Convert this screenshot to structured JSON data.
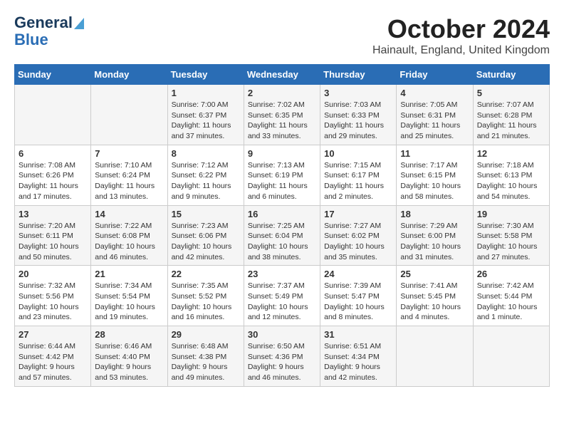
{
  "header": {
    "logo_line1": "General",
    "logo_line2": "Blue",
    "month": "October 2024",
    "location": "Hainault, England, United Kingdom"
  },
  "days_of_week": [
    "Sunday",
    "Monday",
    "Tuesday",
    "Wednesday",
    "Thursday",
    "Friday",
    "Saturday"
  ],
  "weeks": [
    [
      {
        "day": "",
        "info": ""
      },
      {
        "day": "",
        "info": ""
      },
      {
        "day": "1",
        "info": "Sunrise: 7:00 AM\nSunset: 6:37 PM\nDaylight: 11 hours\nand 37 minutes."
      },
      {
        "day": "2",
        "info": "Sunrise: 7:02 AM\nSunset: 6:35 PM\nDaylight: 11 hours\nand 33 minutes."
      },
      {
        "day": "3",
        "info": "Sunrise: 7:03 AM\nSunset: 6:33 PM\nDaylight: 11 hours\nand 29 minutes."
      },
      {
        "day": "4",
        "info": "Sunrise: 7:05 AM\nSunset: 6:31 PM\nDaylight: 11 hours\nand 25 minutes."
      },
      {
        "day": "5",
        "info": "Sunrise: 7:07 AM\nSunset: 6:28 PM\nDaylight: 11 hours\nand 21 minutes."
      }
    ],
    [
      {
        "day": "6",
        "info": "Sunrise: 7:08 AM\nSunset: 6:26 PM\nDaylight: 11 hours\nand 17 minutes."
      },
      {
        "day": "7",
        "info": "Sunrise: 7:10 AM\nSunset: 6:24 PM\nDaylight: 11 hours\nand 13 minutes."
      },
      {
        "day": "8",
        "info": "Sunrise: 7:12 AM\nSunset: 6:22 PM\nDaylight: 11 hours\nand 9 minutes."
      },
      {
        "day": "9",
        "info": "Sunrise: 7:13 AM\nSunset: 6:19 PM\nDaylight: 11 hours\nand 6 minutes."
      },
      {
        "day": "10",
        "info": "Sunrise: 7:15 AM\nSunset: 6:17 PM\nDaylight: 11 hours\nand 2 minutes."
      },
      {
        "day": "11",
        "info": "Sunrise: 7:17 AM\nSunset: 6:15 PM\nDaylight: 10 hours\nand 58 minutes."
      },
      {
        "day": "12",
        "info": "Sunrise: 7:18 AM\nSunset: 6:13 PM\nDaylight: 10 hours\nand 54 minutes."
      }
    ],
    [
      {
        "day": "13",
        "info": "Sunrise: 7:20 AM\nSunset: 6:11 PM\nDaylight: 10 hours\nand 50 minutes."
      },
      {
        "day": "14",
        "info": "Sunrise: 7:22 AM\nSunset: 6:08 PM\nDaylight: 10 hours\nand 46 minutes."
      },
      {
        "day": "15",
        "info": "Sunrise: 7:23 AM\nSunset: 6:06 PM\nDaylight: 10 hours\nand 42 minutes."
      },
      {
        "day": "16",
        "info": "Sunrise: 7:25 AM\nSunset: 6:04 PM\nDaylight: 10 hours\nand 38 minutes."
      },
      {
        "day": "17",
        "info": "Sunrise: 7:27 AM\nSunset: 6:02 PM\nDaylight: 10 hours\nand 35 minutes."
      },
      {
        "day": "18",
        "info": "Sunrise: 7:29 AM\nSunset: 6:00 PM\nDaylight: 10 hours\nand 31 minutes."
      },
      {
        "day": "19",
        "info": "Sunrise: 7:30 AM\nSunset: 5:58 PM\nDaylight: 10 hours\nand 27 minutes."
      }
    ],
    [
      {
        "day": "20",
        "info": "Sunrise: 7:32 AM\nSunset: 5:56 PM\nDaylight: 10 hours\nand 23 minutes."
      },
      {
        "day": "21",
        "info": "Sunrise: 7:34 AM\nSunset: 5:54 PM\nDaylight: 10 hours\nand 19 minutes."
      },
      {
        "day": "22",
        "info": "Sunrise: 7:35 AM\nSunset: 5:52 PM\nDaylight: 10 hours\nand 16 minutes."
      },
      {
        "day": "23",
        "info": "Sunrise: 7:37 AM\nSunset: 5:49 PM\nDaylight: 10 hours\nand 12 minutes."
      },
      {
        "day": "24",
        "info": "Sunrise: 7:39 AM\nSunset: 5:47 PM\nDaylight: 10 hours\nand 8 minutes."
      },
      {
        "day": "25",
        "info": "Sunrise: 7:41 AM\nSunset: 5:45 PM\nDaylight: 10 hours\nand 4 minutes."
      },
      {
        "day": "26",
        "info": "Sunrise: 7:42 AM\nSunset: 5:44 PM\nDaylight: 10 hours\nand 1 minute."
      }
    ],
    [
      {
        "day": "27",
        "info": "Sunrise: 6:44 AM\nSunset: 4:42 PM\nDaylight: 9 hours\nand 57 minutes."
      },
      {
        "day": "28",
        "info": "Sunrise: 6:46 AM\nSunset: 4:40 PM\nDaylight: 9 hours\nand 53 minutes."
      },
      {
        "day": "29",
        "info": "Sunrise: 6:48 AM\nSunset: 4:38 PM\nDaylight: 9 hours\nand 49 minutes."
      },
      {
        "day": "30",
        "info": "Sunrise: 6:50 AM\nSunset: 4:36 PM\nDaylight: 9 hours\nand 46 minutes."
      },
      {
        "day": "31",
        "info": "Sunrise: 6:51 AM\nSunset: 4:34 PM\nDaylight: 9 hours\nand 42 minutes."
      },
      {
        "day": "",
        "info": ""
      },
      {
        "day": "",
        "info": ""
      }
    ]
  ]
}
